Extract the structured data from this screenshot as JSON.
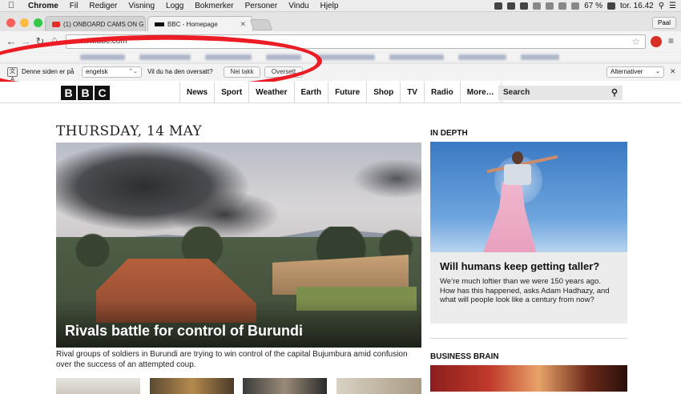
{
  "menubar": {
    "app": "Chrome",
    "items": [
      "Fil",
      "Rediger",
      "Visning",
      "Logg",
      "Bokmerker",
      "Personer",
      "Vindu",
      "Hjelp"
    ],
    "battery": "67 %",
    "clock": "tor. 16.42"
  },
  "browser": {
    "tabs": [
      {
        "title": "(1) ONBOARD CAMS ON G",
        "active": false
      },
      {
        "title": "BBC - Homepage",
        "active": true
      }
    ],
    "profile": "Paal",
    "url": "www.bbc.com"
  },
  "translate_bar": {
    "prefix": "Denne siden er på",
    "language": "engelsk",
    "question": "Vil du ha den oversatt?",
    "decline_label": "Nei takk",
    "accept_label": "Oversett",
    "options_label": "Alternativer"
  },
  "bbc": {
    "logo": [
      "B",
      "B",
      "C"
    ],
    "nav": [
      "News",
      "Sport",
      "Weather",
      "Earth",
      "Future",
      "Shop",
      "TV",
      "Radio",
      "More…"
    ],
    "search_label": "Search",
    "date": "THURSDAY, 14 MAY",
    "hero": {
      "headline": "Rivals battle for control of Burundi",
      "summary": "Rival groups of soldiers in Burundi are trying to win control of the capital Bujumbura amid confusion over the success of an attempted coup."
    },
    "in_depth": {
      "section": "IN DEPTH",
      "headline": "Will humans keep getting taller?",
      "summary": "We’re much loftier than we were 150 years ago. How has this happened, asks Adam Hadhazy, and what will people look like a century from now?"
    },
    "business_brain": {
      "section": "BUSINESS BRAIN"
    }
  },
  "colors": {
    "annotation": "#ec1c24",
    "bbc_black": "#111111",
    "card_bg": "#ececec"
  }
}
